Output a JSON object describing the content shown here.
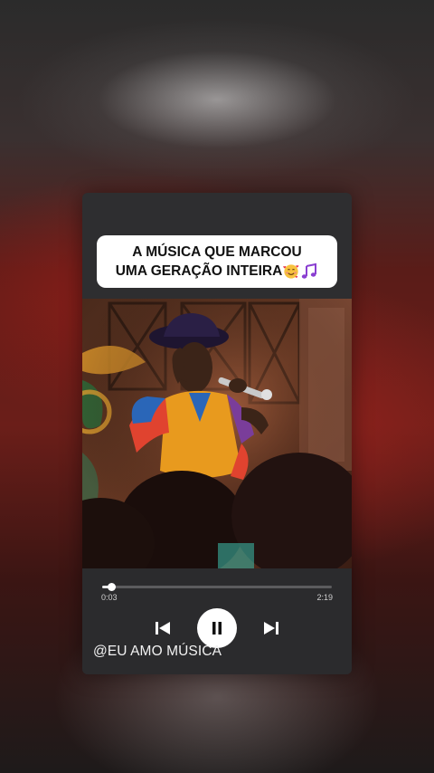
{
  "post": {
    "caption_line1": "A MÚSICA QUE MARCOU",
    "caption_line2": "UMA GERAÇÃO INTEIRA",
    "caption_emojis": [
      "smiling-face-with-hearts",
      "musical-notes"
    ],
    "handle": "@EU AMO MÚSICA"
  },
  "player": {
    "elapsed": "0:03",
    "total": "2:19",
    "progress_fraction": 0.022,
    "state": "playing",
    "controls": [
      "previous-icon",
      "pause-icon",
      "next-icon"
    ]
  },
  "colors": {
    "card_bg": "#2e2e30",
    "caption_bg": "#ffffff",
    "accent_red": "#6b1e19"
  }
}
